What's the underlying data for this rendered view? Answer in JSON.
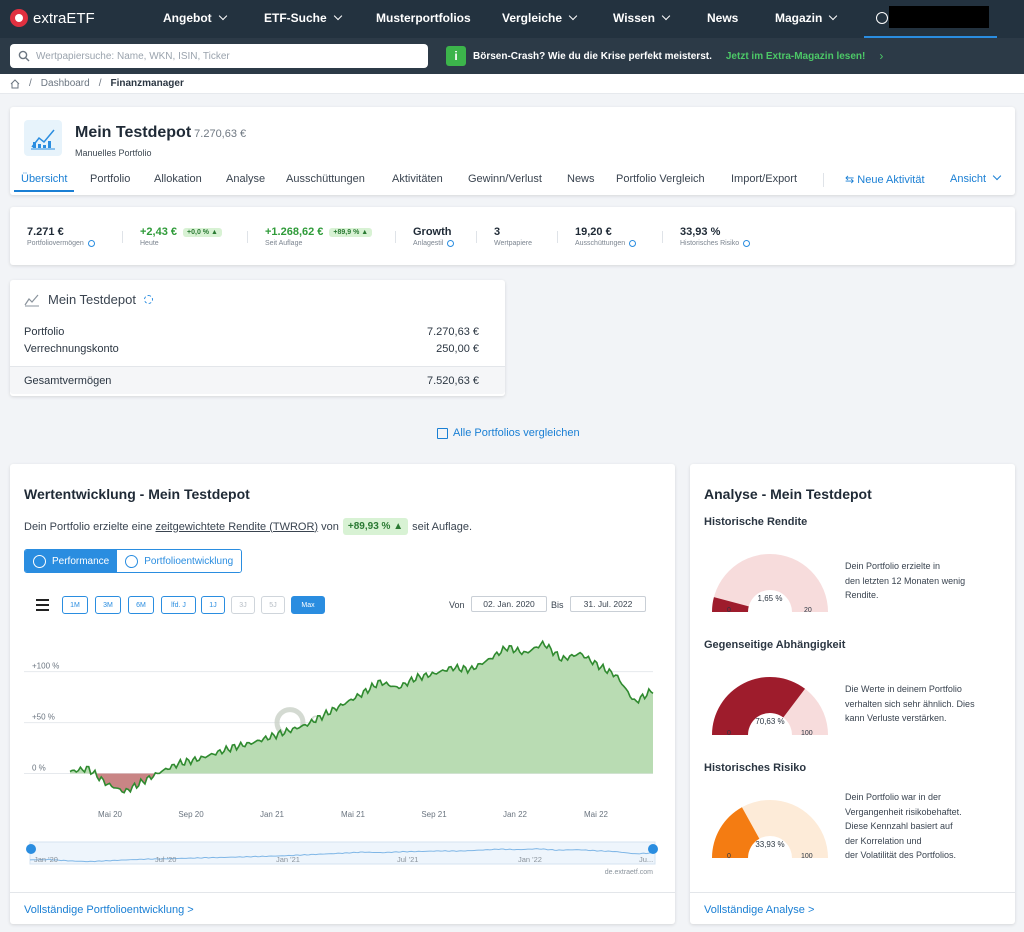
{
  "brand": {
    "name": "extraETF",
    "accent": "#1a7fd4",
    "nav_bg": "#23323f"
  },
  "nav": {
    "items": [
      "Angebot",
      "ETF-Suche",
      "Musterportfolios",
      "Vergleiche",
      "Wissen",
      "News",
      "Magazin"
    ],
    "dropdown": [
      true,
      true,
      false,
      true,
      true,
      false,
      true
    ]
  },
  "search": {
    "placeholder": "Wertpapiersuche: Name, WKN, ISIN, Ticker"
  },
  "promo": {
    "text": "Börsen-Crash? Wie du die Krise perfekt meisterst.",
    "link": "Jetzt im Extra-Magazin lesen!",
    "arrow": "›"
  },
  "breadcrumb": {
    "home_icon": "home-icon",
    "sep": "/",
    "items": [
      "Dashboard",
      "Finanzmanager"
    ]
  },
  "portfolio": {
    "title": "Mein Testdepot",
    "value": "7.270,63 €",
    "subtitle": "Manuelles Portfolio",
    "tabs": [
      "Übersicht",
      "Portfolio",
      "Allokation",
      "Analyse",
      "Ausschüttungen",
      "Aktivitäten",
      "Gewinn/Verlust",
      "News",
      "Portfolio Vergleich",
      "Import/Export"
    ],
    "active_tab": 0,
    "new_activity": "Neue Aktivität",
    "view": "Ansicht"
  },
  "stats": [
    {
      "value": "7.271 €",
      "label": "Portfoliovermögen",
      "info": true
    },
    {
      "value": "+2,43 €",
      "label": "Heute",
      "pill": "+0,0 % ▲",
      "green": true
    },
    {
      "value": "+1.268,62 €",
      "label": "Seit Auflage",
      "pill": "+89,9 % ▲",
      "green": true
    },
    {
      "value": "Growth",
      "label": "Anlagestil",
      "info": true
    },
    {
      "value": "3",
      "label": "Wertpapiere"
    },
    {
      "value": "19,20 €",
      "label": "Ausschüttungen",
      "info": true
    },
    {
      "value": "33,93 %",
      "label": "Historisches Risiko",
      "info": true
    }
  ],
  "depot": {
    "title": "Mein Testdepot",
    "rows": [
      {
        "label": "Portfolio",
        "value": "7.270,63 €"
      },
      {
        "label": "Verrechnungskonto",
        "value": "250,00 €"
      }
    ],
    "total": {
      "label": "Gesamtvermögen",
      "value": "7.520,63 €"
    }
  },
  "compare_link": "Alle Portfolios vergleichen",
  "perf": {
    "title": "Wertentwicklung - Mein Testdepot",
    "text_before": "Dein Portfolio erzielte eine",
    "link": "zeitgewichtete Rendite (TWROR)",
    "text_von": "von",
    "badge": "+89,93 % ▲",
    "text_after": "seit Auflage.",
    "seg_buttons": [
      "Performance",
      "Portfolioentwicklung"
    ],
    "seg_active": 0,
    "ranges": [
      "1M",
      "3M",
      "6M",
      "lfd. J",
      "1J",
      "3J",
      "5J",
      "Max"
    ],
    "range_active": "Max",
    "ranges_disabled": [
      "3J",
      "5J"
    ],
    "von_label": "Von",
    "bis_label": "Bis",
    "date_from": "02. Jan. 2020",
    "date_to": "31. Jul. 2022",
    "footer": "Vollständige Portfolioentwicklung >"
  },
  "chart_data": {
    "type": "area",
    "title": "",
    "xlabel": "",
    "ylabel": "",
    "y_ticks": [
      "+100 %",
      "+50 %",
      "0 %"
    ],
    "x_ticks": [
      "Mai 20",
      "Sep 20",
      "Jan 21",
      "Mai 21",
      "Sep 21",
      "Jan 22",
      "Mai 22"
    ],
    "navigator_ticks": [
      "Jan '20",
      "Jul '20",
      "Jan '21",
      "Jul '21",
      "Jan '22",
      "Ju..."
    ],
    "watermark": "extraETF",
    "source": "de.extraetf.com",
    "ylim": [
      -25,
      135
    ],
    "colors": {
      "positive": "#b9dcb3",
      "positive_line": "#2f8a2f",
      "negative": "#c98585",
      "negative_line": "#9b1c1c"
    },
    "series": [
      {
        "x": [
          "2020-01",
          "2020-02",
          "2020-03",
          "2020-03b",
          "2020-04",
          "2020-05",
          "2020-06",
          "2020-07",
          "2020-08",
          "2020-09",
          "2020-10",
          "2020-11",
          "2020-12",
          "2021-01",
          "2021-02",
          "2021-03",
          "2021-04",
          "2021-05",
          "2021-06",
          "2021-07",
          "2021-08",
          "2021-09",
          "2021-10",
          "2021-11",
          "2021-11b",
          "2021-12",
          "2022-01",
          "2022-02",
          "2022-03",
          "2022-04",
          "2022-05",
          "2022-06",
          "2022-07"
        ],
        "values": [
          2,
          5,
          -10,
          -18,
          -8,
          2,
          10,
          14,
          20,
          26,
          30,
          36,
          42,
          48,
          58,
          68,
          78,
          90,
          84,
          94,
          98,
          104,
          102,
          112,
          124,
          118,
          128,
          112,
          118,
          106,
          96,
          70,
          82
        ]
      }
    ]
  },
  "analysis": {
    "title": "Analyse - Mein Testdepot",
    "footer": "Vollständige Analyse >",
    "blocks": [
      {
        "title": "Historische Rendite",
        "value": "1,65 %",
        "min": "0",
        "max": "20",
        "fraction": 0.0825,
        "color": "#9e1c2c",
        "track": "#f7dcdc",
        "desc": [
          "Dein Portfolio erzielte in",
          "den letzten 12 Monaten wenig",
          "Rendite."
        ]
      },
      {
        "title": "Gegenseitige Abhängigkeit",
        "value": "70,63 %",
        "min": "0",
        "max": "100",
        "fraction": 0.7063,
        "color": "#9e1c2c",
        "track": "#f7dcdc",
        "desc": [
          "Die Werte in deinem Portfolio",
          "verhalten sich sehr ähnlich. Dies",
          "kann Verluste verstärken."
        ]
      },
      {
        "title": "Historisches Risiko",
        "value": "33,93 %",
        "min": "0",
        "max": "100",
        "fraction": 0.3393,
        "color": "#f47c12",
        "track": "#fdebd8",
        "desc": [
          "Dein Portfolio war in der",
          "Vergangenheit risikobehaftet.",
          "Diese Kennzahl basiert auf",
          "der Korrelation und",
          "der Volatilität des Portfolios."
        ]
      }
    ]
  }
}
